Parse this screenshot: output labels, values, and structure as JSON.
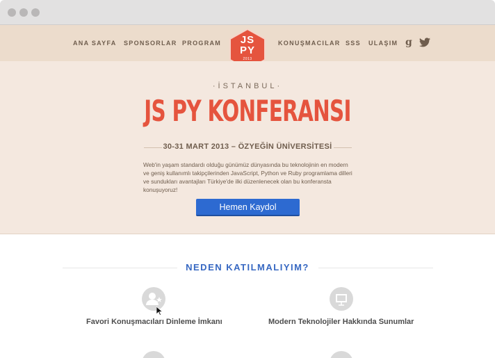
{
  "nav": {
    "links": [
      "ANA SAYFA",
      "SPONSORLAR",
      "PROGRAM",
      "KONUŞMACILAR",
      "SSS",
      "ULAŞIM"
    ],
    "social": {
      "google_icon": "google-icon",
      "twitter_icon": "twitter-icon"
    }
  },
  "logo": {
    "line1": "JS",
    "line2": "PY",
    "year": "2013"
  },
  "hero": {
    "eyebrow": "·İSTANBUL·",
    "title": "JS PY KONFERANSI",
    "dateline": "30-31 MART 2013 – ÖZYEĞİN ÜNİVERSİTESİ",
    "description": "Web'in yaşam standardı olduğu günümüz dünyasında bu teknolojinin en modern ve geniş kullanımlı takipçilerinden JavaScript, Python ve Ruby programlama dilleri ve sundukları avantajları Türkiye'de ilki düzenlenecek olan bu konferansta konuşuyoruz!",
    "cta_label": "Hemen Kaydol"
  },
  "why": {
    "title": "NEDEN KATILMALIYIM?",
    "features": [
      {
        "label": "Favori Konuşmacıları Dinleme İmkanı",
        "icon": "speaker-icon"
      },
      {
        "label": "Modern Teknolojiler Hakkında Sunumlar",
        "icon": "presentation-icon"
      }
    ]
  },
  "colors": {
    "accent": "#e5543e",
    "cta": "#2d6ad1",
    "hero_bg": "#f4e8df",
    "nav_bg": "#ecdccc",
    "section_title": "#3768c2"
  }
}
